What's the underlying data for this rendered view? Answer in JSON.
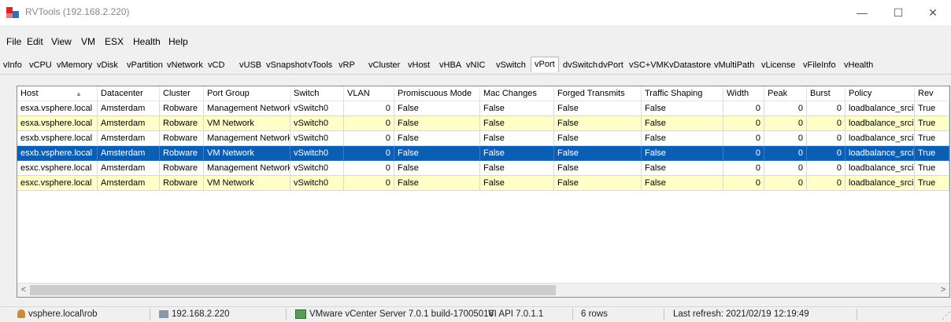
{
  "window": {
    "title": "RVTools (192.168.2.220)",
    "minimize": "—",
    "maximize": "☐",
    "close": "✕"
  },
  "menu": [
    "File",
    "Edit",
    "View",
    "VM",
    "ESX",
    "Health",
    "Help"
  ],
  "tabs": [
    "vInfo",
    "vCPU",
    "vMemory",
    "vDisk",
    "vPartition",
    "vNetwork",
    "vCD",
    "vUSB",
    "vSnapshot",
    "vTools",
    "vRP",
    "vCluster",
    "vHost",
    "vHBA",
    "vNIC",
    "vSwitch",
    "vPort",
    "dvSwitch",
    "dvPort",
    "vSC+VMK",
    "vDatastore",
    "vMultiPath",
    "vLicense",
    "vFileInfo",
    "vHealth"
  ],
  "active_tab": "vPort",
  "grid": {
    "columns": [
      "Host",
      "Datacenter",
      "Cluster",
      "Port Group",
      "Switch",
      "VLAN",
      "Promiscuous Mode",
      "Mac Changes",
      "Forged Transmits",
      "Traffic Shaping",
      "Width",
      "Peak",
      "Burst",
      "Policy",
      "Rev"
    ],
    "sort_indicator": "▲",
    "rows": [
      {
        "style": "white",
        "cells": [
          "esxa.vsphere.local",
          "Amsterdam",
          "Robware",
          "Management Network",
          "vSwitch0",
          "0",
          "False",
          "False",
          "False",
          "False",
          "0",
          "0",
          "0",
          "loadbalance_srcid",
          "True"
        ]
      },
      {
        "style": "yellow",
        "cells": [
          "esxa.vsphere.local",
          "Amsterdam",
          "Robware",
          "VM Network",
          "vSwitch0",
          "0",
          "False",
          "False",
          "False",
          "False",
          "0",
          "0",
          "0",
          "loadbalance_srcid",
          "True"
        ]
      },
      {
        "style": "white",
        "cells": [
          "esxb.vsphere.local",
          "Amsterdam",
          "Robware",
          "Management Network",
          "vSwitch0",
          "0",
          "False",
          "False",
          "False",
          "False",
          "0",
          "0",
          "0",
          "loadbalance_srcid",
          "True"
        ]
      },
      {
        "style": "selected",
        "cells": [
          "esxb.vsphere.local",
          "Amsterdam",
          "Robware",
          "VM Network",
          "vSwitch0",
          "0",
          "False",
          "False",
          "False",
          "False",
          "0",
          "0",
          "0",
          "loadbalance_srcid",
          "True"
        ]
      },
      {
        "style": "white",
        "cells": [
          "esxc.vsphere.local",
          "Amsterdam",
          "Robware",
          "Management Network",
          "vSwitch0",
          "0",
          "False",
          "False",
          "False",
          "False",
          "0",
          "0",
          "0",
          "loadbalance_srcid",
          "True"
        ]
      },
      {
        "style": "yellow",
        "cells": [
          "esxc.vsphere.local",
          "Amsterdam",
          "Robware",
          "VM Network",
          "vSwitch0",
          "0",
          "False",
          "False",
          "False",
          "False",
          "0",
          "0",
          "0",
          "loadbalance_srcid",
          "True"
        ]
      }
    ],
    "scroll_left": "<",
    "scroll_right": ">"
  },
  "status": {
    "user": "vsphere.local\\rob",
    "host": "192.168.2.220",
    "server": "VMware vCenter Server 7.0.1 build-17005016",
    "api": "VI API 7.0.1.1",
    "rows": "6 rows",
    "refresh": "Last refresh: 2021/02/19 12:19:49"
  },
  "colors": {
    "selected": "#0a5fb4",
    "alt_row": "#ffffc8",
    "brand_red": "#d9262e",
    "brand_blue": "#2d6fc4"
  }
}
